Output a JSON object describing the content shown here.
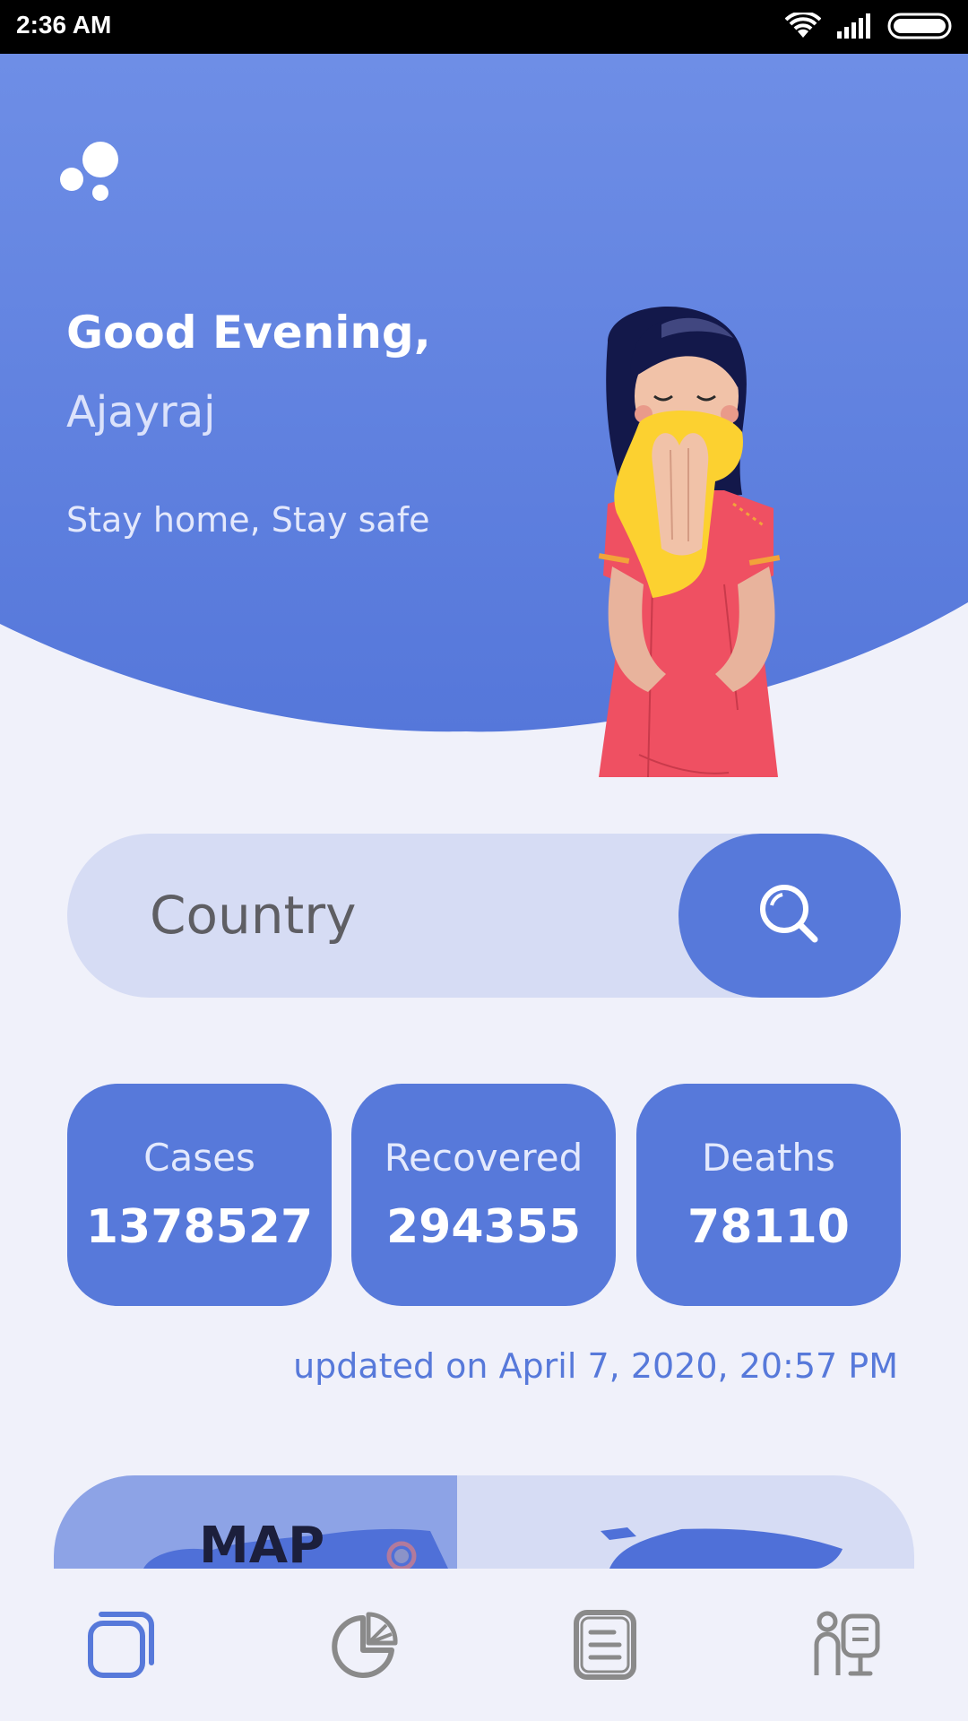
{
  "status_bar": {
    "time": "2:36 AM"
  },
  "header": {
    "greeting": "Good Evening,",
    "username": "Ajayraj",
    "tagline": "Stay home, Stay safe"
  },
  "search": {
    "placeholder": "Country"
  },
  "stats": [
    {
      "label": "Cases",
      "value": "1378527"
    },
    {
      "label": "Recovered",
      "value": "294355"
    },
    {
      "label": "Deaths",
      "value": "78110"
    }
  ],
  "updated_text": "updated on April 7, 2020, 20:57 PM",
  "map_card": {
    "title": "MAP"
  },
  "bottom_nav": [
    {
      "icon": "home-icon",
      "active": true
    },
    {
      "icon": "pie-chart-icon",
      "active": false
    },
    {
      "icon": "news-icon",
      "active": false
    },
    {
      "icon": "doctor-icon",
      "active": false
    }
  ],
  "colors": {
    "primary": "#5779da",
    "primary_light": "#d6dcf4",
    "background": "#f0f1fa",
    "inactive_icon": "#8a8a8a"
  }
}
